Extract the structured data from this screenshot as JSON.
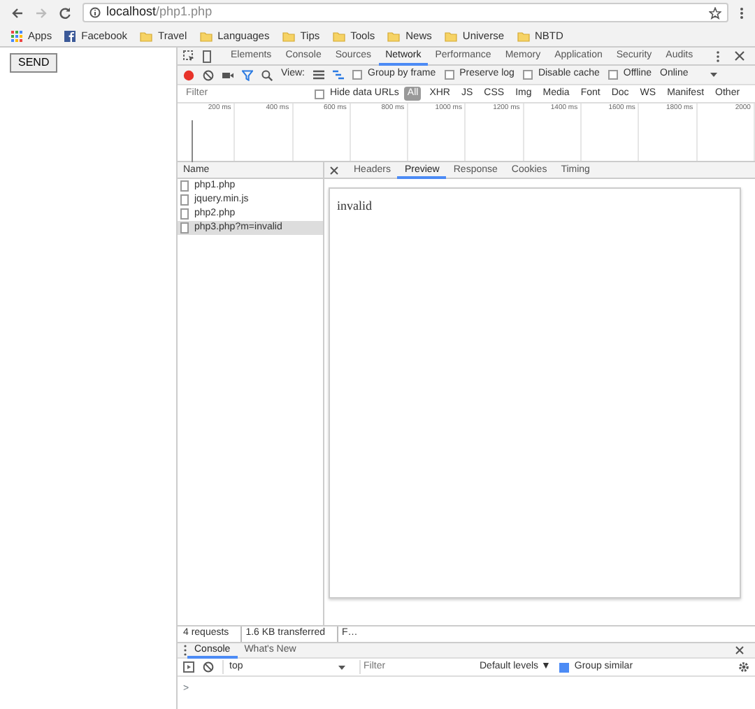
{
  "browser": {
    "address": {
      "host": "localhost",
      "path": "/php1.php"
    },
    "bookmarks": [
      {
        "label": "Apps",
        "kind": "apps"
      },
      {
        "label": "Facebook",
        "kind": "facebook"
      },
      {
        "label": "Travel",
        "kind": "folder"
      },
      {
        "label": "Languages",
        "kind": "folder"
      },
      {
        "label": "Tips",
        "kind": "folder"
      },
      {
        "label": "Tools",
        "kind": "folder"
      },
      {
        "label": "News",
        "kind": "folder"
      },
      {
        "label": "Universe",
        "kind": "folder"
      },
      {
        "label": "NBTD",
        "kind": "folder"
      }
    ]
  },
  "page": {
    "button": "SEND"
  },
  "devtools": {
    "tabs": [
      {
        "label": "Elements",
        "selected": false
      },
      {
        "label": "Console",
        "selected": false
      },
      {
        "label": "Sources",
        "selected": false
      },
      {
        "label": "Network",
        "selected": true
      },
      {
        "label": "Performance",
        "selected": false
      },
      {
        "label": "Memory",
        "selected": false
      },
      {
        "label": "Application",
        "selected": false
      },
      {
        "label": "Security",
        "selected": false
      },
      {
        "label": "Audits",
        "selected": false
      }
    ],
    "toolbar": {
      "recording": true,
      "view_label": "View:",
      "options": [
        {
          "label": "Group by frame",
          "checked": false
        },
        {
          "label": "Preserve log",
          "checked": false
        },
        {
          "label": "Disable cache",
          "checked": false
        },
        {
          "label": "Offline",
          "checked": false
        }
      ],
      "throttling": "Online"
    },
    "filter": {
      "placeholder": "Filter",
      "hide_data_urls": {
        "label": "Hide data URLs",
        "checked": false
      },
      "types": [
        {
          "label": "All",
          "selected": true
        },
        {
          "label": "XHR",
          "selected": false
        },
        {
          "label": "JS",
          "selected": false
        },
        {
          "label": "CSS",
          "selected": false
        },
        {
          "label": "Img",
          "selected": false
        },
        {
          "label": "Media",
          "selected": false
        },
        {
          "label": "Font",
          "selected": false
        },
        {
          "label": "Doc",
          "selected": false
        },
        {
          "label": "WS",
          "selected": false
        },
        {
          "label": "Manifest",
          "selected": false
        },
        {
          "label": "Other",
          "selected": false
        }
      ]
    },
    "timeline": {
      "ticks": [
        "200 ms",
        "400 ms",
        "600 ms",
        "800 ms",
        "1000 ms",
        "1200 ms",
        "1400 ms",
        "1600 ms",
        "1800 ms",
        "2000"
      ]
    },
    "requests": {
      "column": "Name",
      "items": [
        {
          "name": "php1.php",
          "selected": false
        },
        {
          "name": "jquery.min.js",
          "selected": false
        },
        {
          "name": "php2.php",
          "selected": false
        },
        {
          "name": "php3.php?m=invalid",
          "selected": true
        }
      ]
    },
    "detail": {
      "tabs": [
        {
          "label": "Headers",
          "selected": false
        },
        {
          "label": "Preview",
          "selected": true
        },
        {
          "label": "Response",
          "selected": false
        },
        {
          "label": "Cookies",
          "selected": false
        },
        {
          "label": "Timing",
          "selected": false
        }
      ],
      "preview": "invalid"
    },
    "status": [
      "4 requests",
      "1.6 KB transferred",
      "F…"
    ],
    "drawer": {
      "tabs": [
        {
          "label": "Console",
          "selected": true
        },
        {
          "label": "What's New",
          "selected": false
        }
      ],
      "context": "top",
      "filter_placeholder": "Filter",
      "levels": "Default levels ▼",
      "group_similar": {
        "label": "Group similar",
        "checked": true
      },
      "prompt": ">"
    }
  }
}
